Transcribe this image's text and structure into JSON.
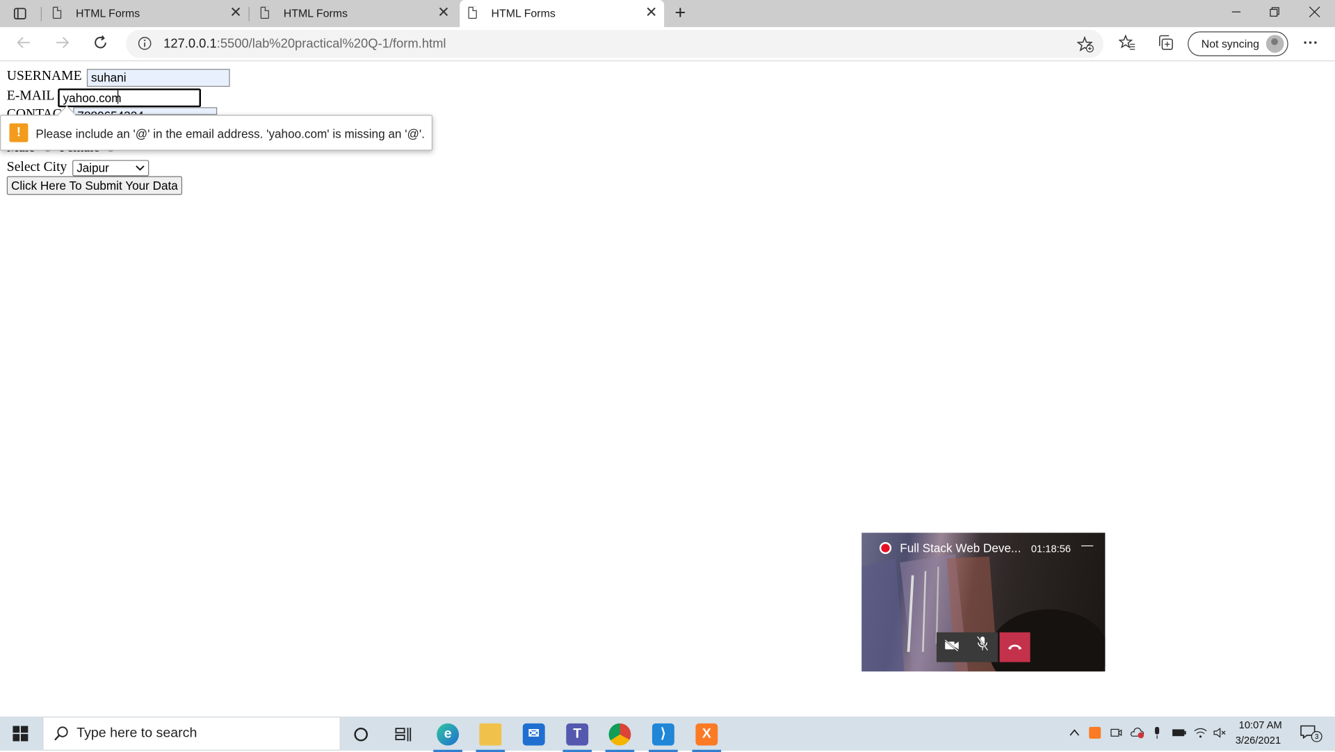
{
  "browser": {
    "tabs": [
      {
        "title": "HTML Forms",
        "close": "✕"
      },
      {
        "title": "HTML Forms",
        "close": "✕"
      },
      {
        "title": "HTML Forms",
        "close": "✕"
      }
    ],
    "new_tab": "+",
    "url_host": "127.0.0.1",
    "url_rest": ":5500/lab%20practical%20Q-1/form.html",
    "sync_label": "Not syncing"
  },
  "form": {
    "username_label": "USERNAME",
    "username_value": "suhani",
    "email_label": "E-MAIL",
    "email_value": "yahoo.com",
    "contact_label": "CONTAC",
    "contact_value": "7880654324",
    "gender_male": "Male",
    "gender_female": "Female",
    "city_label": "Select City",
    "city_value": "Jaipur",
    "submit_label": "Click Here To Submit Your Data",
    "validation_message": "Please include an '@' in the email address. 'yahoo.com' is missing an '@'."
  },
  "video_call": {
    "title": "Full Stack Web Deve...",
    "time": "01:18:56",
    "minimize": "—"
  },
  "taskbar": {
    "search_placeholder": "Type here to search",
    "clock_time": "10:07 AM",
    "clock_date": "3/26/2021",
    "notification_count": "3"
  },
  "colors": {
    "tab_strip": "#cdcdcd",
    "warning": "#f29b1d",
    "end_call": "#c4314b",
    "taskbar": "#d5e0e8"
  }
}
